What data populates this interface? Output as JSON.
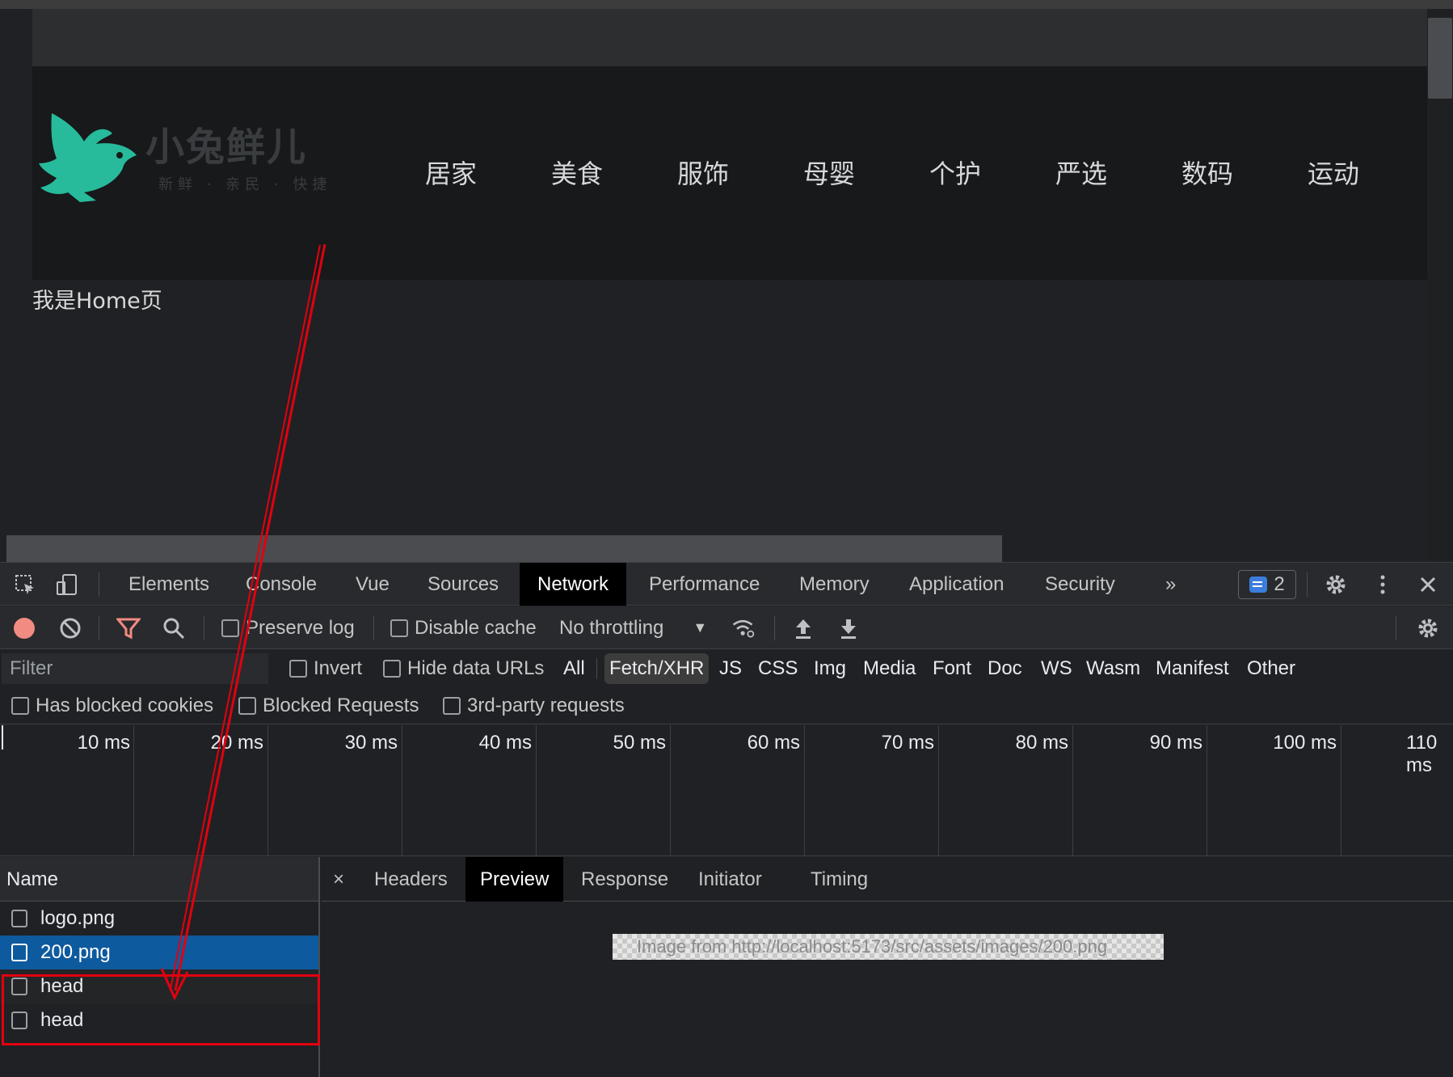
{
  "page": {
    "logo": {
      "name": "小兔鲜儿",
      "slogan": "新鲜 · 亲民 · 快捷",
      "brand_color": "#27ba9b"
    },
    "nav": [
      "居家",
      "美食",
      "服饰",
      "母婴",
      "个护",
      "严选",
      "数码",
      "运动"
    ],
    "home_text": "我是Home页"
  },
  "devtools": {
    "tabs": [
      "Elements",
      "Console",
      "Vue",
      "Sources",
      "Network",
      "Performance",
      "Memory",
      "Application",
      "Security"
    ],
    "active_tab": "Network",
    "more_tabs_icon": "»",
    "issues_count": "2",
    "toolbar": {
      "preserve_log": "Preserve log",
      "disable_cache": "Disable cache",
      "throttling": "No throttling"
    },
    "filter": {
      "placeholder": "Filter",
      "invert": "Invert",
      "hide_data_urls": "Hide data URLs",
      "types": [
        "All",
        "Fetch/XHR",
        "JS",
        "CSS",
        "Img",
        "Media",
        "Font",
        "Doc",
        "WS",
        "Wasm",
        "Manifest",
        "Other"
      ],
      "active_type": "Fetch/XHR"
    },
    "cookie_filters": [
      "Has blocked cookies",
      "Blocked Requests",
      "3rd-party requests"
    ],
    "timeline_ticks": [
      "10 ms",
      "20 ms",
      "30 ms",
      "40 ms",
      "50 ms",
      "60 ms",
      "70 ms",
      "80 ms",
      "90 ms",
      "100 ms",
      "110 ms"
    ],
    "name_header": "Name",
    "requests": [
      "logo.png",
      "200.png",
      "head",
      "head"
    ],
    "selected_request": "200.png",
    "detail_tabs": [
      "Headers",
      "Preview",
      "Response",
      "Initiator",
      "Timing"
    ],
    "active_detail_tab": "Preview",
    "close_symbol": "×",
    "preview_alt": "Image from http://localhost:5173/src/assets/images/200.png"
  },
  "colors": {
    "record": "#f28b82",
    "filter_icon": "#f28b82",
    "selected_row": "#0e5a9e",
    "annotation": "#e3000f"
  }
}
